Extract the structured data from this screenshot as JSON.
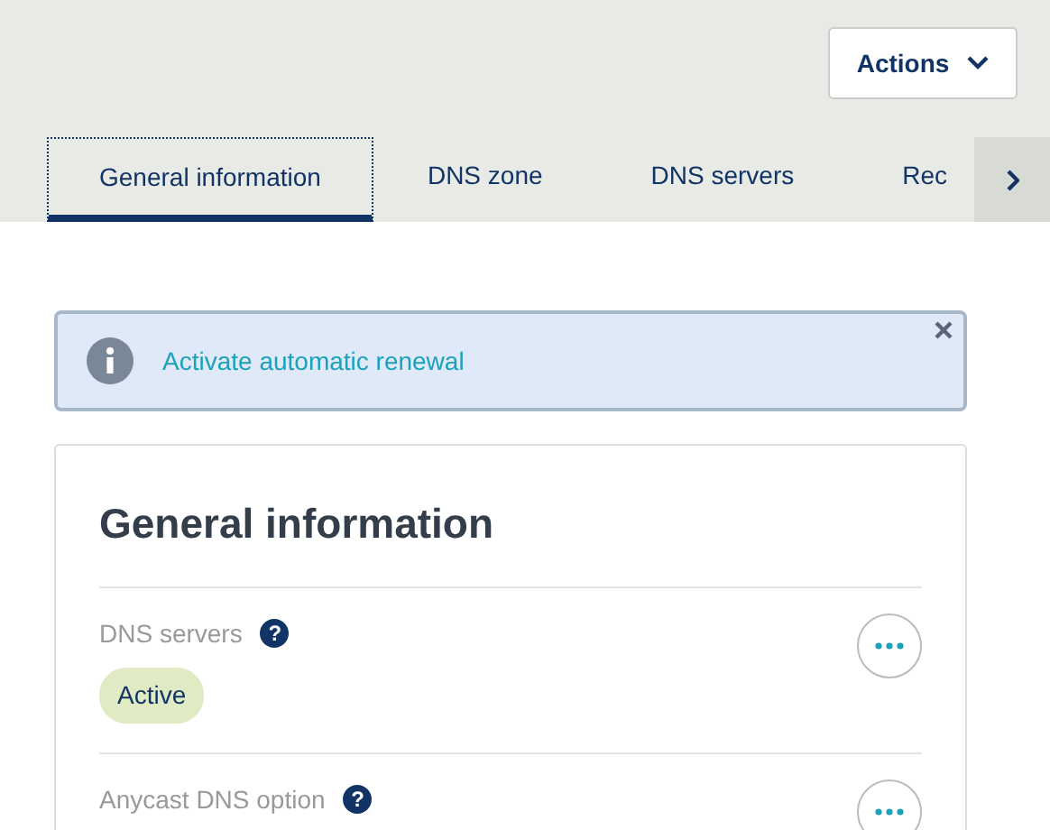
{
  "actions_button": {
    "label": "Actions"
  },
  "tabs": [
    {
      "label": "General information",
      "selected": true
    },
    {
      "label": "DNS zone",
      "selected": false
    },
    {
      "label": "DNS servers",
      "selected": false
    },
    {
      "label": "Rec",
      "selected": false
    }
  ],
  "alert": {
    "text": "Activate automatic renewal"
  },
  "section": {
    "title": "General information",
    "rows": [
      {
        "label": "DNS servers",
        "help": "?",
        "badge": "Active"
      },
      {
        "label": "Anycast DNS option",
        "help": "?"
      }
    ]
  }
}
